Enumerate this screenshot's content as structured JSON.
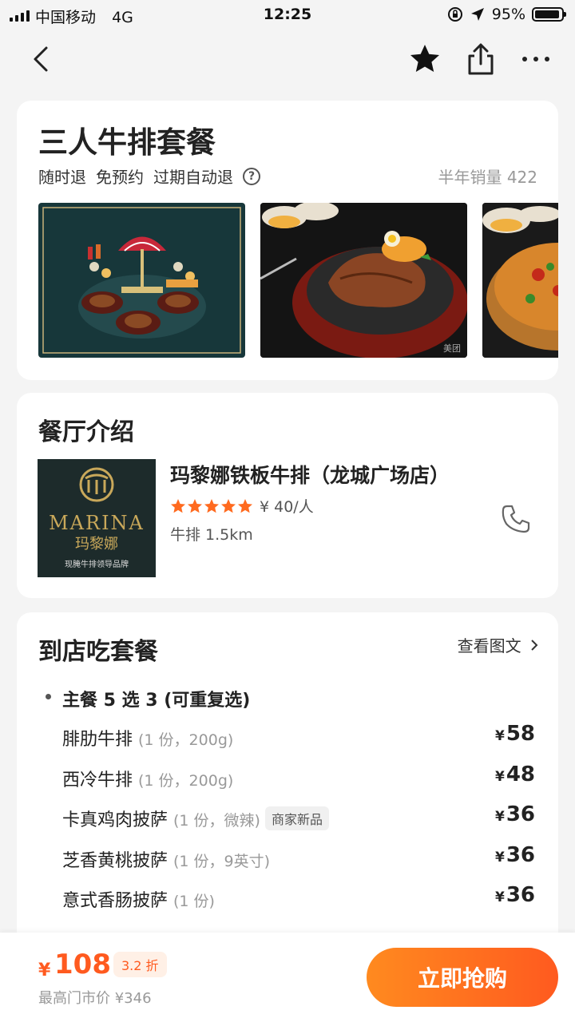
{
  "status_bar": {
    "carrier": "中国移动",
    "network": "4G",
    "time": "12:25",
    "battery": "95%",
    "battery_level": 0.95
  },
  "deal": {
    "title": "三人牛排套餐",
    "tags": [
      "随时退",
      "免预约",
      "过期自动退"
    ],
    "sales": "半年销量 422",
    "watermark": "美团"
  },
  "restaurant": {
    "section_title": "餐厅介绍",
    "name": "玛黎娜铁板牛排（龙城广场店）",
    "price": "¥ 40/人",
    "rating": 5,
    "category_distance": "牛排  1.5km",
    "logo_text": "MARINA",
    "logo_cn": "玛黎娜",
    "logo_slogan": "现腌牛排领导品牌"
  },
  "menu": {
    "section_title": "到店吃套餐",
    "view_link": "查看图文",
    "group_title": "主餐 5 选 3 (可重复选)",
    "items": [
      {
        "name": "腓肋牛排",
        "note": "(1 份，200g)",
        "badge": "",
        "price": "58"
      },
      {
        "name": "西冷牛排",
        "note": "(1 份，200g)",
        "badge": "",
        "price": "48"
      },
      {
        "name": "卡真鸡肉披萨",
        "note": "(1 份，微辣)",
        "badge": "商家新品",
        "price": "36"
      },
      {
        "name": "芝香黄桃披萨",
        "note": "(1 份，9英寸)",
        "badge": "",
        "price": "36"
      },
      {
        "name": "意式香肠披萨",
        "note": "(1 份)",
        "badge": "",
        "price": "36"
      }
    ],
    "currency": "¥"
  },
  "bottom_bar": {
    "currency": "¥",
    "price": "108",
    "discount": "3.2 折",
    "original": "最高门市价 ¥346",
    "buy_label": "立即抢购"
  },
  "colors": {
    "accent": "#ff5a1f",
    "star": "#ff6a1f"
  }
}
